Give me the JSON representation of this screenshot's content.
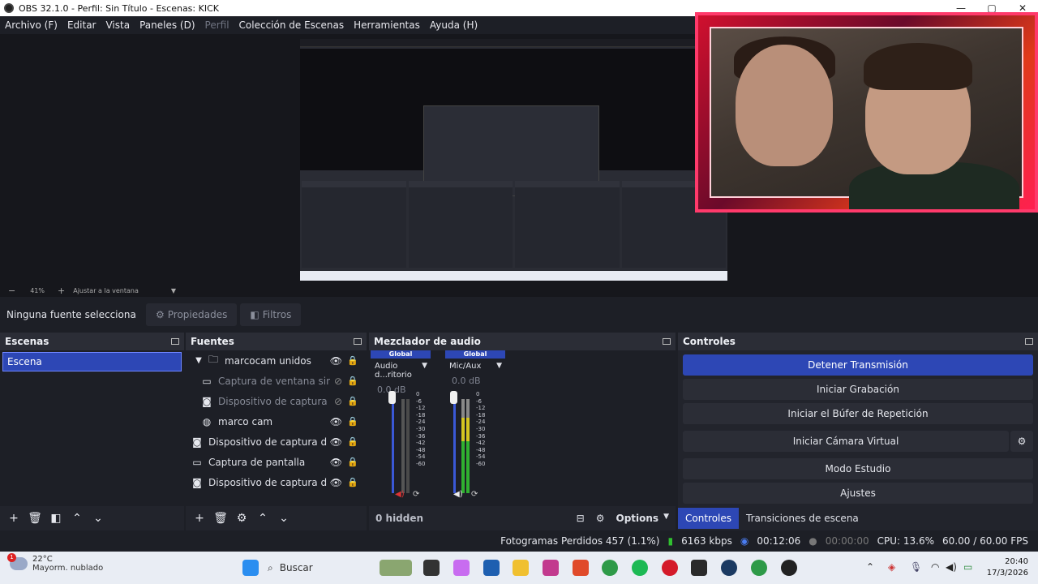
{
  "window": {
    "title": "OBS 32.1.0 - Perfil: Sin Título - Escenas: KICK",
    "controls": [
      "—",
      "▢",
      "✕"
    ]
  },
  "menu": [
    {
      "label": "Archivo (F)",
      "disabled": false
    },
    {
      "label": "Editar",
      "disabled": false
    },
    {
      "label": "Vista",
      "disabled": false
    },
    {
      "label": "Paneles (D)",
      "disabled": false
    },
    {
      "label": "Perfil",
      "disabled": true
    },
    {
      "label": "Colección de Escenas",
      "disabled": false
    },
    {
      "label": "Herramientas",
      "disabled": false
    },
    {
      "label": "Ayuda (H)",
      "disabled": false
    }
  ],
  "zoom": {
    "minus": "−",
    "level": "41%",
    "plus": "+",
    "fit_label": "Ajustar a la ventana"
  },
  "source_toolbar": {
    "no_source": "Ninguna fuente selecciona",
    "properties": "Propiedades",
    "filters": "Filtros"
  },
  "scenes": {
    "title": "Escenas",
    "items": [
      "Escena"
    ]
  },
  "sources": {
    "title": "Fuentes",
    "items": [
      {
        "label": "marcocam unidos",
        "icon": "folder-icon",
        "dim": false
      },
      {
        "label": "Captura de ventana singular",
        "icon": "window-icon",
        "dim": true
      },
      {
        "label": "Dispositivo de captura de video",
        "icon": "camera-icon",
        "dim": true
      },
      {
        "label": "marco cam",
        "icon": "globe-icon",
        "dim": false
      },
      {
        "label": "Dispositivo de captura de video",
        "icon": "camera-icon",
        "dim": false
      },
      {
        "label": "Captura de pantalla",
        "icon": "monitor-icon",
        "dim": false
      },
      {
        "label": "Dispositivo de captura de video",
        "icon": "camera-icon",
        "dim": false
      }
    ]
  },
  "mixer": {
    "title": "Mezclador de audio",
    "channels": [
      {
        "badge": "Global",
        "name": "Audio d...ritorio",
        "db": "0.0 dB",
        "muted": true
      },
      {
        "badge": "Global",
        "name": "Mic/Aux",
        "db": "0.0 dB",
        "muted": false
      }
    ],
    "ticks": [
      "0",
      "-6",
      "-12",
      "-18",
      "-24",
      "-30",
      "-36",
      "-42",
      "-48",
      "-54",
      "-60"
    ],
    "hidden": "0 hidden",
    "options": "Options"
  },
  "controls": {
    "title": "Controles",
    "buttons": [
      {
        "label": "Detener Transmisión",
        "active": true
      },
      {
        "label": "Iniciar Grabación",
        "active": false
      },
      {
        "label": "Iniciar el Búfer de Repetición",
        "active": false
      },
      {
        "label": "Iniciar Cámara Virtual",
        "active": false
      },
      {
        "label": "Modo Estudio",
        "active": false
      },
      {
        "label": "Ajustes",
        "active": false
      }
    ],
    "tabs": [
      "Controles",
      "Transiciones de escena"
    ]
  },
  "status": {
    "dropped": "Fotogramas Perdidos 457 (1.1%)",
    "bitrate": "6163 kbps",
    "stream_time": "00:12:06",
    "rec_time": "00:00:00",
    "cpu": "CPU: 13.6%",
    "fps": "60.00 / 60.00 FPS"
  },
  "taskbar": {
    "weather_temp": "22°C",
    "weather_desc": "Mayorm. nublado",
    "weather_badge": "1",
    "search": "Buscar",
    "time": "20:40",
    "date": "17/3/2026"
  },
  "colors": {
    "accent": "#2d47b5",
    "panel": "#22242c",
    "background": "#1d1f26"
  }
}
